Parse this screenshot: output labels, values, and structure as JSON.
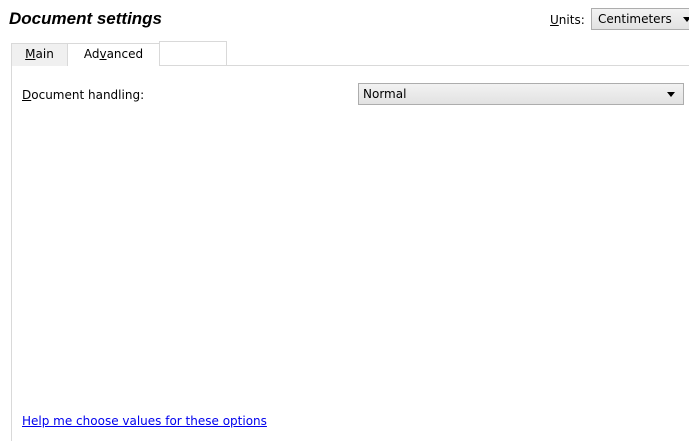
{
  "header": {
    "title": "Document settings",
    "units_label_accel": "U",
    "units_label_rest": "nits:",
    "units_value": "Centimeters"
  },
  "tabs": [
    {
      "pre": "",
      "accel": "M",
      "post": "ain"
    },
    {
      "pre": "Ad",
      "accel": "v",
      "post": "anced"
    }
  ],
  "form": {
    "document_handling_label_accel": "D",
    "document_handling_label_rest": "ocument handling:",
    "document_handling_value": "Normal"
  },
  "help_link": "Help me choose values for these options",
  "colors": {
    "link": "#0000ee",
    "tab_border": "#d9d9d9"
  }
}
